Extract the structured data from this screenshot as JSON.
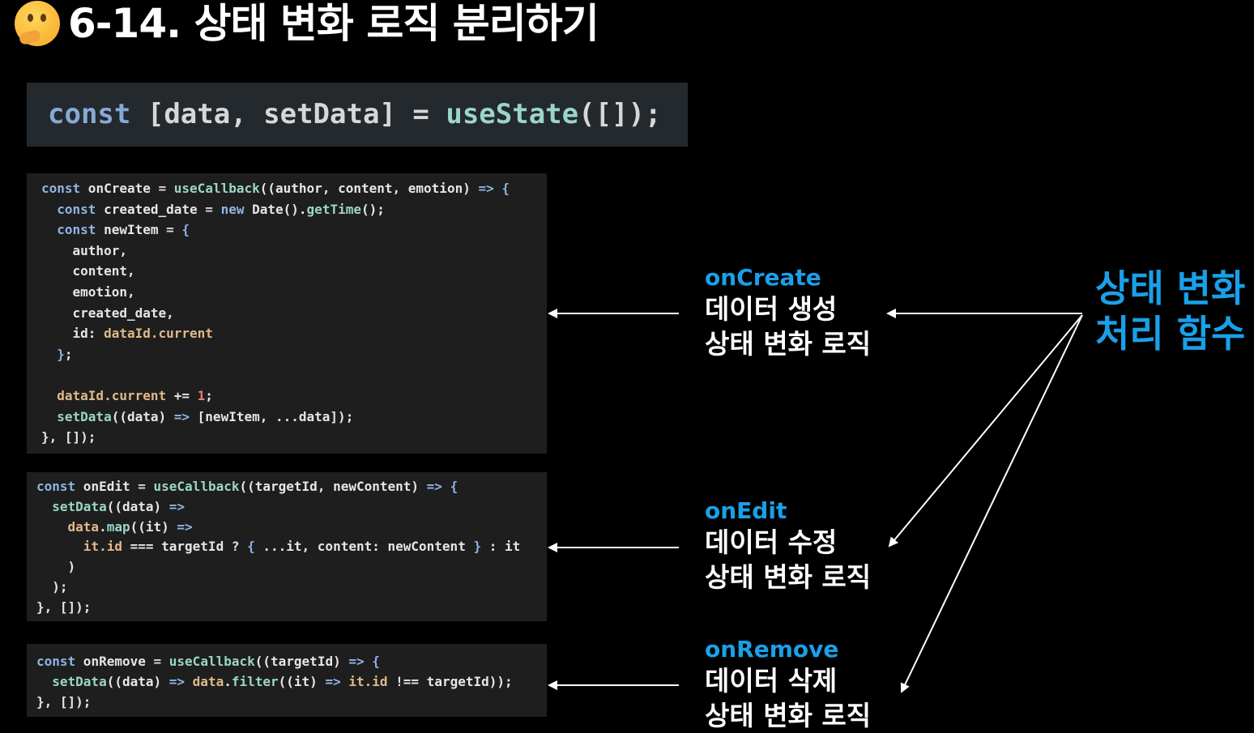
{
  "header": {
    "title": "6-14. 상태 변화 로직 분리하기",
    "emoji_icon": "thinking-face-icon"
  },
  "state_decl": {
    "keyword": "const",
    "destructure": "[data, setData]",
    "eq": "=",
    "call": "useState",
    "args": "([]);"
  },
  "code_blocks": [
    {
      "name": "onCreate",
      "lines": [
        "const onCreate = useCallback((author, content, emotion) => {",
        "  const created_date = new Date().getTime();",
        "  const newItem = {",
        "    author,",
        "    content,",
        "    emotion,",
        "    created_date,",
        "    id: dataId.current",
        "  };",
        "",
        "  dataId.current += 1;",
        "  setData((data) => [newItem, ...data]);",
        "}, []);"
      ]
    },
    {
      "name": "onEdit",
      "lines": [
        "const onEdit = useCallback((targetId, newContent) => {",
        "  setData((data) =>",
        "    data.map((it) =>",
        "      it.id === targetId ? { ...it, content: newContent } : it",
        "    )",
        "  );",
        "}, []);"
      ]
    },
    {
      "name": "onRemove",
      "lines": [
        "const onRemove = useCallback((targetId) => {",
        "  setData((data) => data.filter((it) => it.id !== targetId));",
        "}, []);"
      ]
    }
  ],
  "labels": [
    {
      "name": "onCreate",
      "line1": "데이터 생성",
      "line2": "상태 변화 로직"
    },
    {
      "name": "onEdit",
      "line1": "데이터 수정",
      "line2": "상태 변화 로직"
    },
    {
      "name": "onRemove",
      "line1": "데이터 삭제",
      "line2": "상태 변화 로직"
    }
  ],
  "summary_label": {
    "line1": "상태 변화",
    "line2": "처리 함수"
  },
  "colors": {
    "background": "#000000",
    "accent_blue": "#1aa0e8",
    "code_bg": "#1e1e1e"
  }
}
